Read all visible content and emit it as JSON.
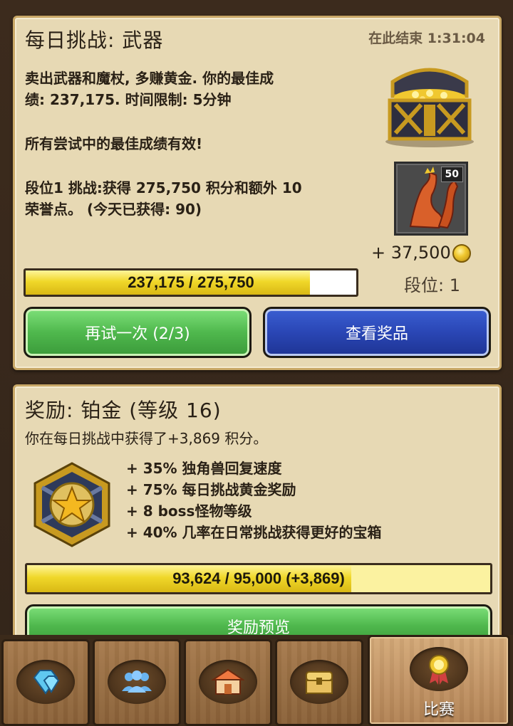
{
  "challenge": {
    "title": "每日挑战: 武器",
    "timer": "在此结束 1:31:04",
    "description_line1": "卖出武器和魔杖, 多赚黄金. 你的最佳成",
    "description_line2": "绩: 237,175. 时间限制: 5分钟",
    "best_note": "所有尝试中的最佳成绩有效!",
    "tier_line1": "段位1 挑战:获得 275,750 积分和额外 10",
    "tier_line2": "荣誉点。 (今天已获得: 90)",
    "reward_badge": "50",
    "gold_reward": "+ 37,500",
    "tier_label": "段位: 1",
    "progress": {
      "text": "237,175 / 275,750",
      "fraction": 0.86
    },
    "retry_label": "再试一次 (2/3)",
    "view_prizes_label": "查看奖品"
  },
  "reward": {
    "title": "奖励: 铂金 (等级 16)",
    "earned_text": "你在每日挑战中获得了+3,869 积分。",
    "bonuses": [
      "+ 35% 独角兽回复速度",
      "+ 75% 每日挑战黄金奖励",
      "+ 8 boss怪物等级",
      "+ 40% 几率在日常挑战获得更好的宝箱"
    ],
    "progress": {
      "main": "93,624 / 95,000",
      "delta": "(+3,869)",
      "fraction": 0.7
    },
    "preview_label": "奖励预览"
  },
  "nav": {
    "tabs": [
      {
        "icon": "gem-icon",
        "label": ""
      },
      {
        "icon": "people-icon",
        "label": ""
      },
      {
        "icon": "shop-icon",
        "label": ""
      },
      {
        "icon": "chest-icon",
        "label": ""
      },
      {
        "icon": "medal-icon",
        "label": "比赛"
      }
    ],
    "active_index": 4
  },
  "colors": {
    "panel": "#e7d9b4",
    "progress_fill": "#f0d82a",
    "button_green": "#4fb84d",
    "button_blue": "#2a46b5"
  }
}
